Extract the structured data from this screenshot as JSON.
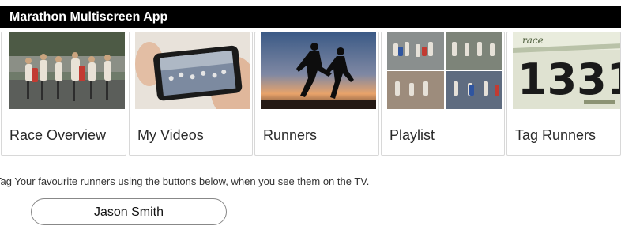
{
  "app": {
    "title": "Marathon Multiscreen App"
  },
  "tiles": [
    {
      "label": "Race Overview",
      "image": "marathon-crowd-photo"
    },
    {
      "label": "My Videos",
      "image": "phone-recording-photo"
    },
    {
      "label": "Runners",
      "image": "runner-silhouettes-photo"
    },
    {
      "label": "Playlist",
      "image": "photo-collage"
    },
    {
      "label": "Tag Runners",
      "image": "race-bib-photo"
    }
  ],
  "instructions": "Tag Your favourite runners using the buttons below, when you see them on the TV.",
  "runners": [
    {
      "name": "Jason Smith"
    }
  ],
  "colors": {
    "app_bar": "#000000",
    "tile_border": "#d8d8d8",
    "text": "#2a2a2a"
  }
}
